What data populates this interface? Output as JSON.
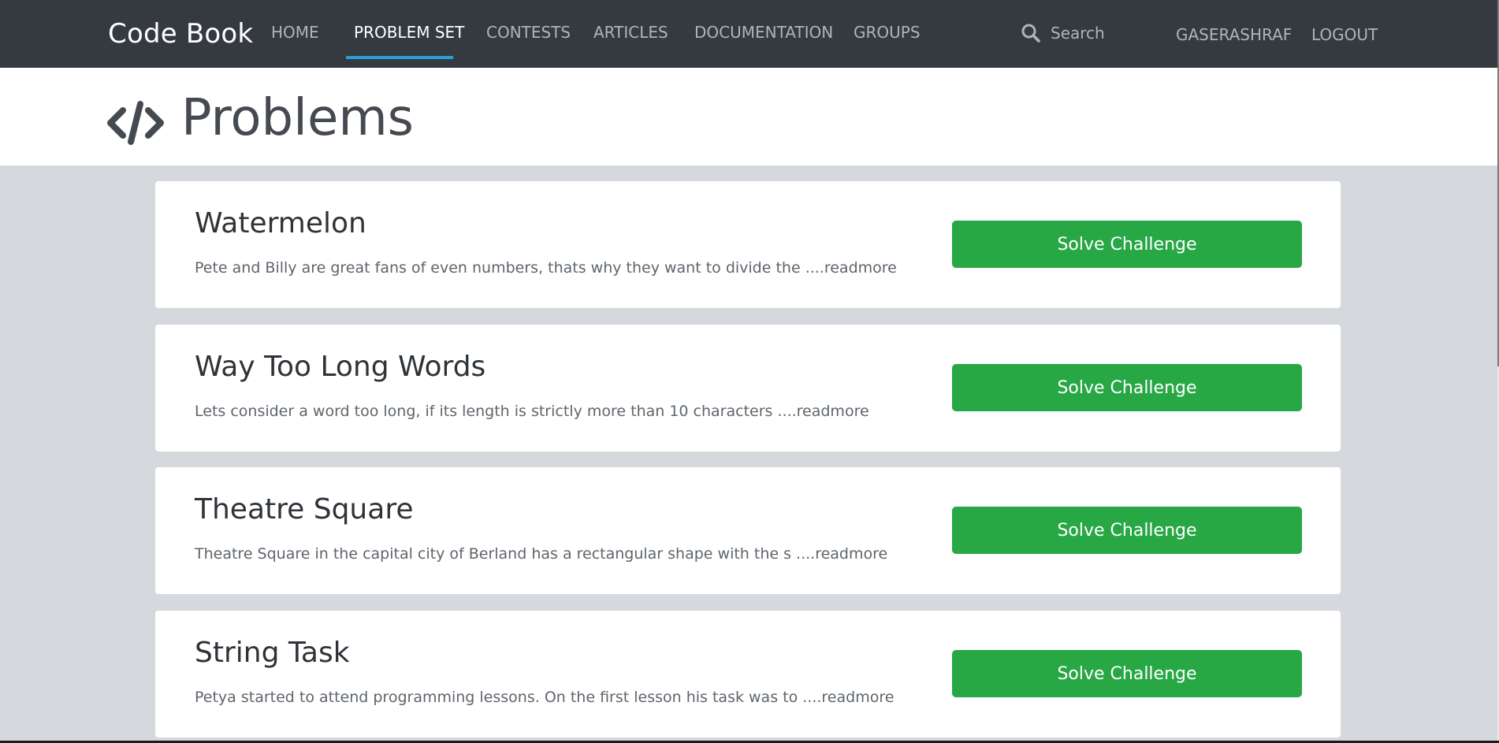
{
  "nav": {
    "brand": "Code Book",
    "items": [
      {
        "label": "HOME",
        "active": false
      },
      {
        "label": "PROBLEM SET",
        "active": true
      },
      {
        "label": "CONTESTS",
        "active": false
      },
      {
        "label": "ARTICLES",
        "active": false
      },
      {
        "label": "DOCUMENTATION",
        "active": false
      },
      {
        "label": "GROUPS",
        "active": false
      }
    ],
    "search_placeholder": "Search",
    "username": "GASERASHRAF",
    "logout": "LOGOUT"
  },
  "page": {
    "title": "Problems",
    "icon": "code-icon"
  },
  "problems": [
    {
      "title": "Watermelon",
      "description": "Pete and Billy are great fans of even numbers, thats why they want to divide the ",
      "readmore": "....readmore",
      "button": "Solve Challenge"
    },
    {
      "title": "Way Too Long Words",
      "description": "Lets consider a word too long, if its length is strictly more than 10 characters ",
      "readmore": "....readmore",
      "button": "Solve Challenge"
    },
    {
      "title": "Theatre Square",
      "description": "Theatre Square in the capital city of Berland has a rectangular shape with the s ",
      "readmore": "....readmore",
      "button": "Solve Challenge"
    },
    {
      "title": "String Task",
      "description": "Petya started to attend programming lessons. On the first lesson his task was to ",
      "readmore": "....readmore",
      "button": "Solve Challenge"
    }
  ],
  "colors": {
    "navbar": "#343a40",
    "active_underline": "#2a9fd8",
    "button": "#28a745",
    "background": "#d5d9dd"
  }
}
